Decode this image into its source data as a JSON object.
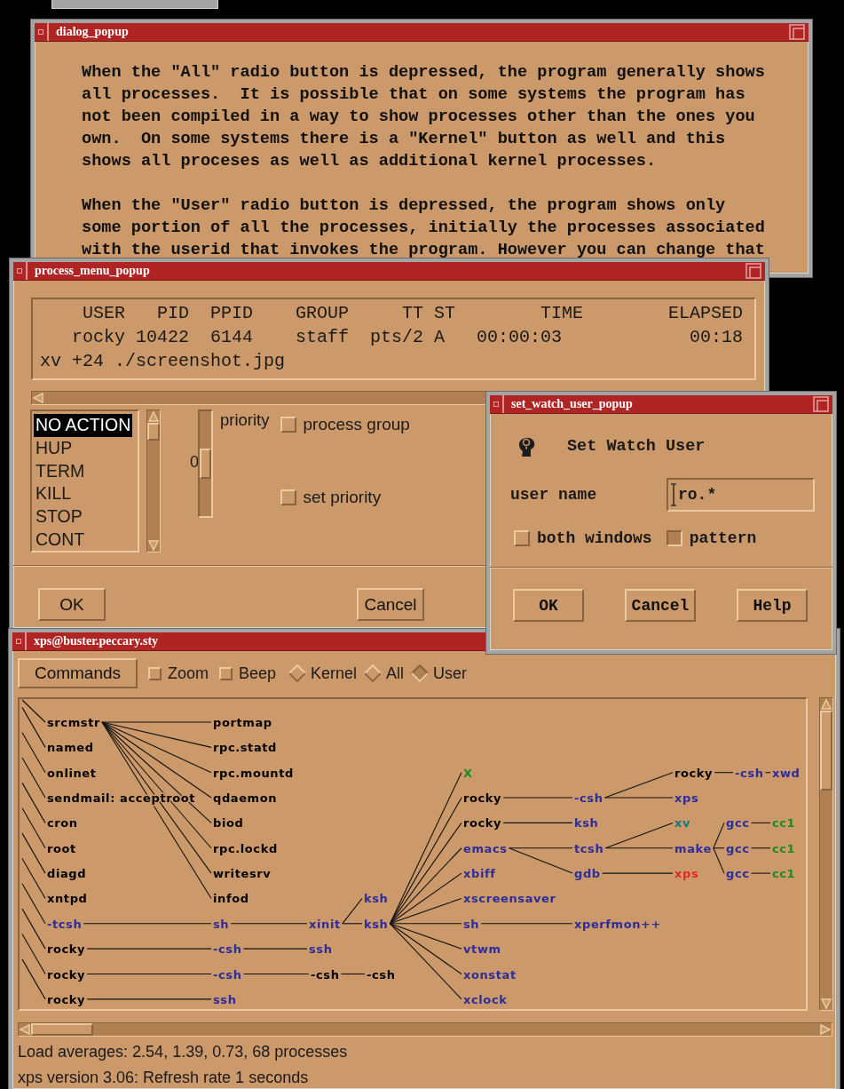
{
  "dialog": {
    "title": "dialog_popup",
    "paragraphs": [
      "When the \"All\" radio button is depressed, the program generally shows\nall processes.  It is possible that on some systems the program has\nnot been compiled in a way to show processes other than the ones you\nown.  On some systems there is a \"Kernel\" button as well and this\nshows all proceses as well as additional kernel processes.",
      "When the \"User\" radio button is depressed, the program shows only\nsome portion of all the processes, initially the processes associated\nwith the userid that invokes the program. However you can change that"
    ]
  },
  "process_menu": {
    "title": "process_menu_popup",
    "columns": [
      "USER",
      "PID",
      "PPID",
      "GROUP",
      "TT",
      "ST",
      "TIME",
      "ELAPSED"
    ],
    "values": [
      "rocky",
      "10422",
      "6144",
      "staff",
      "pts/2",
      "A",
      "00:00:03",
      "00:18"
    ],
    "command": "xv +24 ./screenshot.jpg",
    "signals": [
      {
        "label": "NO ACTION",
        "selected": true
      },
      {
        "label": "HUP",
        "selected": false
      },
      {
        "label": "TERM",
        "selected": false
      },
      {
        "label": "KILL",
        "selected": false
      },
      {
        "label": "STOP",
        "selected": false
      },
      {
        "label": "CONT",
        "selected": false
      }
    ],
    "priority": {
      "label": "priority",
      "reading": "0",
      "level": 0.5
    },
    "options": [
      {
        "label": "process group",
        "checked": false
      },
      {
        "label": "set priority",
        "checked": false
      }
    ],
    "buttons": [
      "OK",
      "Cancel"
    ]
  },
  "xps": {
    "title": "xps@buster.peccary.sty",
    "commands_button": "Commands",
    "toggles": [
      {
        "label": "Zoom",
        "checked": false
      },
      {
        "label": "Beep",
        "checked": false
      }
    ],
    "modes": [
      {
        "label": "Kernel",
        "selected": false
      },
      {
        "label": "All",
        "selected": false
      },
      {
        "label": "User",
        "selected": true
      }
    ],
    "process_tree": [
      {
        "name": "srcmstr",
        "color": "#000000",
        "children": [
          {
            "name": "portmap",
            "color": "#000000"
          },
          {
            "name": "rpc.statd",
            "color": "#000000"
          },
          {
            "name": "rpc.mountd",
            "color": "#000000"
          },
          {
            "name": "qdaemon",
            "color": "#000000"
          },
          {
            "name": "biod",
            "color": "#000000"
          },
          {
            "name": "rpc.lockd",
            "color": "#000000"
          },
          {
            "name": "writesrv",
            "color": "#000000"
          },
          {
            "name": "infod",
            "color": "#000000"
          }
        ]
      },
      {
        "name": "named",
        "color": "#000000"
      },
      {
        "name": "onlinet",
        "color": "#000000"
      },
      {
        "name": "sendmail: acceptroot",
        "color": "#000000"
      },
      {
        "name": "cron",
        "color": "#000000"
      },
      {
        "name": "root",
        "color": "#000000"
      },
      {
        "name": "diagd",
        "color": "#000000"
      },
      {
        "name": "xntpd",
        "color": "#000000"
      },
      {
        "name": "-tcsh",
        "color": "#2c2c9c",
        "children": [
          {
            "name": "sh",
            "color": "#2c2c9c",
            "children": [
              {
                "name": "xinit",
                "color": "#2c2c9c",
                "children": [
                  {
                    "name": "ksh",
                    "color": "#2c2c9c"
                  },
                  {
                    "name": "ksh",
                    "color": "#2c2c9c",
                    "children": [
                      {
                        "name": "X",
                        "color": "#1e8a1e"
                      },
                      {
                        "name": "rocky",
                        "color": "#000000",
                        "children": [
                          {
                            "name": "-csh",
                            "color": "#2c2c9c",
                            "children": [
                              {
                                "name": "rocky",
                                "color": "#000000",
                                "children": [
                                  {
                                    "name": "-csh",
                                    "color": "#2c2c9c",
                                    "children": [
                                      {
                                        "name": "xwd",
                                        "color": "#2c2c9c"
                                      }
                                    ]
                                  }
                                ]
                              },
                              {
                                "name": "xps",
                                "color": "#2c2c9c"
                              }
                            ]
                          }
                        ]
                      },
                      {
                        "name": "rocky",
                        "color": "#000000",
                        "children": [
                          {
                            "name": "ksh",
                            "color": "#2c2c9c"
                          }
                        ]
                      },
                      {
                        "name": "emacs",
                        "color": "#2c2c9c",
                        "children": [
                          {
                            "name": "tcsh",
                            "color": "#2c2c9c",
                            "children": [
                              {
                                "name": "xv",
                                "color": "#0e7a82"
                              },
                              {
                                "name": "make",
                                "color": "#2c2c9c",
                                "children": [
                                  {
                                    "name": "gcc",
                                    "color": "#2c2c9c",
                                    "children": [
                                      {
                                        "name": "cc1",
                                        "color": "#1e8a1e"
                                      }
                                    ]
                                  },
                                  {
                                    "name": "gcc",
                                    "color": "#2c2c9c",
                                    "children": [
                                      {
                                        "name": "cc1",
                                        "color": "#1e8a1e"
                                      }
                                    ]
                                  },
                                  {
                                    "name": "gcc",
                                    "color": "#2c2c9c",
                                    "children": [
                                      {
                                        "name": "cc1",
                                        "color": "#1e8a1e"
                                      }
                                    ]
                                  }
                                ]
                              }
                            ]
                          },
                          {
                            "name": "gdb",
                            "color": "#2c2c9c",
                            "children": [
                              {
                                "name": "xps",
                                "color": "#e02828"
                              }
                            ]
                          }
                        ]
                      },
                      {
                        "name": "xbiff",
                        "color": "#2c2c9c"
                      },
                      {
                        "name": "xscreensaver",
                        "color": "#2c2c9c"
                      },
                      {
                        "name": "sh",
                        "color": "#2c2c9c",
                        "children": [
                          {
                            "name": "xperfmon++",
                            "color": "#2c2c9c"
                          }
                        ]
                      },
                      {
                        "name": "vtwm",
                        "color": "#2c2c9c"
                      },
                      {
                        "name": "xonstat",
                        "color": "#2c2c9c"
                      },
                      {
                        "name": "xclock",
                        "color": "#2c2c9c"
                      }
                    ]
                  }
                ]
              }
            ]
          }
        ]
      },
      {
        "name": "rocky",
        "color": "#000000",
        "children": [
          {
            "name": "-csh",
            "color": "#2c2c9c",
            "children": [
              {
                "name": "ssh",
                "color": "#2c2c9c"
              }
            ]
          }
        ]
      },
      {
        "name": "rocky",
        "color": "#000000",
        "children": [
          {
            "name": "-csh",
            "color": "#2c2c9c",
            "children": [
              {
                "name": "-csh",
                "color": "#000000",
                "children": [
                  {
                    "name": "-csh",
                    "color": "#000000"
                  }
                ]
              }
            ]
          }
        ]
      },
      {
        "name": "rocky",
        "color": "#000000",
        "children": [
          {
            "name": "ssh",
            "color": "#2c2c9c"
          }
        ]
      }
    ],
    "status": [
      "Load averages: 2.54, 1.39, 0.73, 68 processes",
      "xps version 3.06: Refresh rate 1 seconds"
    ]
  },
  "set_watch_user": {
    "title": "set_watch_user_popup",
    "heading": "Set Watch User",
    "field_label": "user name",
    "field_value": "ro.*",
    "options": [
      {
        "label": "both windows",
        "checked": false
      },
      {
        "label": "pattern",
        "checked": true
      }
    ],
    "buttons": [
      "OK",
      "Cancel",
      "Help"
    ]
  }
}
